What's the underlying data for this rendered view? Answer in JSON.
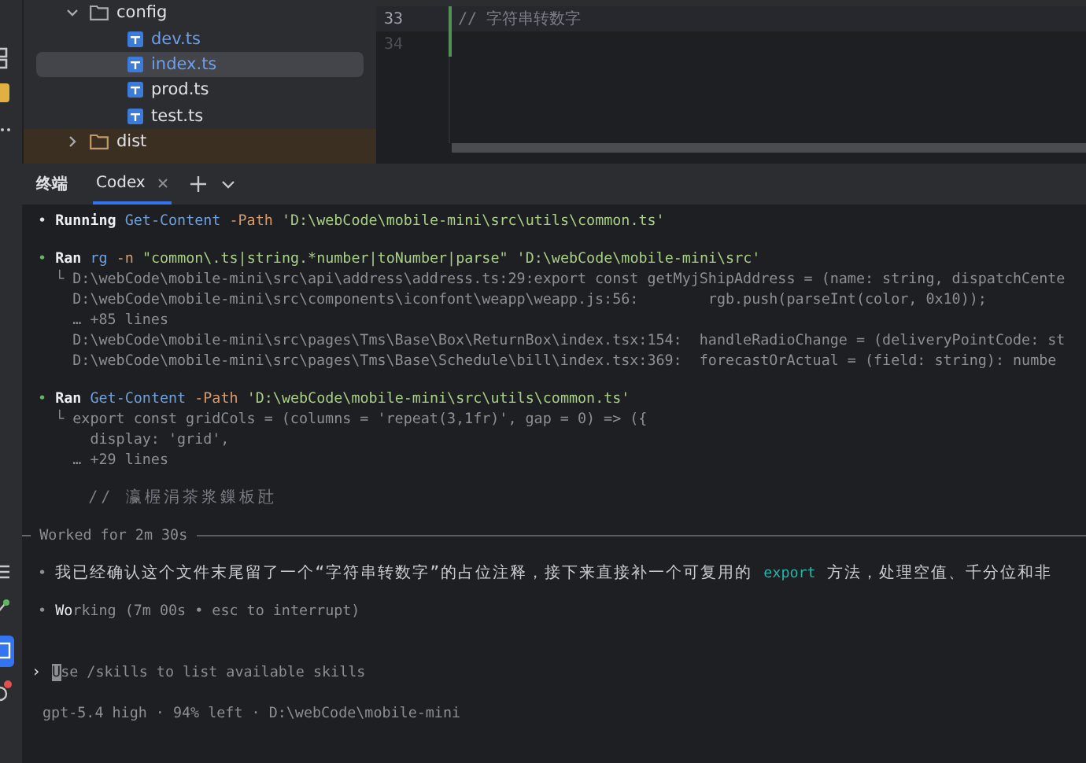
{
  "file_tree": {
    "items": [
      {
        "label": "config",
        "kind": "folder",
        "expanded": true,
        "excluded": false,
        "children": [
          {
            "label": "dev.ts",
            "kind": "ts",
            "selected": false,
            "modified": true
          },
          {
            "label": "index.ts",
            "kind": "ts",
            "selected": true,
            "modified": true
          },
          {
            "label": "prod.ts",
            "kind": "ts",
            "selected": false,
            "modified": false
          },
          {
            "label": "test.ts",
            "kind": "ts",
            "selected": false,
            "modified": false
          }
        ]
      },
      {
        "label": "dist",
        "kind": "folder",
        "expanded": false,
        "excluded": true
      }
    ]
  },
  "editor": {
    "lines": [
      {
        "number": "33",
        "text": "// 字符串转数字",
        "current": true
      },
      {
        "number": "34",
        "current": false
      }
    ]
  },
  "terminal": {
    "title": "终端",
    "tabs": [
      {
        "label": "Codex",
        "selected": true
      }
    ],
    "blocks": [
      {
        "kind": "entry",
        "lines": [
          {
            "segments": [
              {
                "text": "• ",
                "kind": "active"
              },
              {
                "text": "Running ",
                "kind": "verb"
              },
              {
                "text": "Get-Content ",
                "kind": "command"
              },
              {
                "text": "-Path ",
                "kind": "flag"
              },
              {
                "text": "'D:\\webCode\\mobile-mini\\src\\utils\\common.ts'",
                "kind": "path"
              }
            ]
          }
        ]
      },
      {
        "kind": "entry",
        "lines": [
          {
            "segments": [
              {
                "text": "• ",
                "kind": "bullet"
              },
              {
                "text": "Ran ",
                "kind": "verb"
              },
              {
                "text": "rg ",
                "kind": "command"
              },
              {
                "text": "-n ",
                "kind": "flag"
              },
              {
                "text": "\"common\\.ts|string.*number|toNumber|parse\" ",
                "kind": "path"
              },
              {
                "text": "'D:\\webCode\\mobile-mini\\src'",
                "kind": "path"
              }
            ]
          },
          {
            "segments": [
              {
                "text": "  └ D:\\webCode\\mobile-mini\\src\\api\\address\\address.ts:29:export const getMyjShipAddress = (name: string, dispatchCente",
                "kind": "output"
              }
            ]
          },
          {
            "segments": [
              {
                "text": "    D:\\webCode\\mobile-mini\\src\\components\\iconfont\\weapp\\weapp.js:56:        rgb.push(parseInt(color, 0x10));",
                "kind": "output"
              }
            ]
          },
          {
            "segments": [
              {
                "text": "    … +85 lines",
                "kind": "output"
              }
            ]
          },
          {
            "segments": [
              {
                "text": "    D:\\webCode\\mobile-mini\\src\\pages\\Tms\\Base\\Box\\ReturnBox\\index.tsx:154:  handleRadioChange = (deliveryPointCode: st",
                "kind": "output"
              }
            ]
          },
          {
            "segments": [
              {
                "text": "    D:\\webCode\\mobile-mini\\src\\pages\\Tms\\Base\\Schedule\\bill\\index.tsx:369:  forecastOrActual = (field: string): numbe",
                "kind": "output"
              }
            ]
          }
        ]
      },
      {
        "kind": "entry",
        "lines": [
          {
            "segments": [
              {
                "text": "• ",
                "kind": "bullet"
              },
              {
                "text": "Ran ",
                "kind": "verb"
              },
              {
                "text": "Get-Content ",
                "kind": "command"
              },
              {
                "text": "-Path ",
                "kind": "flag"
              },
              {
                "text": "'D:\\webCode\\mobile-mini\\src\\utils\\common.ts'",
                "kind": "path"
              }
            ]
          },
          {
            "segments": [
              {
                "text": "  └ export const gridCols = (columns = 'repeat(3,1fr)', gap = 0) => ({",
                "kind": "output"
              }
            ]
          },
          {
            "segments": [
              {
                "text": "      display: 'grid',",
                "kind": "output"
              }
            ]
          },
          {
            "segments": [
              {
                "text": "    … +29 lines",
                "kind": "output"
              }
            ]
          }
        ]
      },
      {
        "kind": "entry",
        "lines": [
          {
            "segments": [
              {
                "text": "    // 瀛楃涓茶浆鏁板瓧",
                "kind": "comment"
              }
            ]
          }
        ]
      },
      {
        "kind": "divider",
        "lines": [
          {
            "segments": [
              {
                "text": "— Worked for 2m 30s",
                "kind": "output"
              }
            ]
          }
        ]
      },
      {
        "kind": "entry",
        "lines": [
          {
            "segments": [
              {
                "text": "• ",
                "kind": "dot"
              },
              {
                "text": "我已经确认这个文件末尾留了一个“字符串转数字”的占位注释，接下来直接补一个可复用的 ",
                "kind": "message"
              },
              {
                "text": "export",
                "kind": "code"
              },
              {
                "text": " 方法，处理空值、千分位和非",
                "kind": "message"
              }
            ]
          }
        ]
      },
      {
        "kind": "entry",
        "lines": [
          {
            "segments": [
              {
                "text": "• ",
                "kind": "dot"
              },
              {
                "text": "Wo",
                "kind": "highlight"
              },
              {
                "text": "rking (7m 00s • esc to interrupt)",
                "kind": "output"
              }
            ]
          }
        ]
      }
    ],
    "prompt": {
      "symbol": "›",
      "placeholder": "Use /skills to list available skills"
    },
    "footer": "gpt-5.4 high · 94% left · D:\\webCode\\mobile-mini"
  }
}
